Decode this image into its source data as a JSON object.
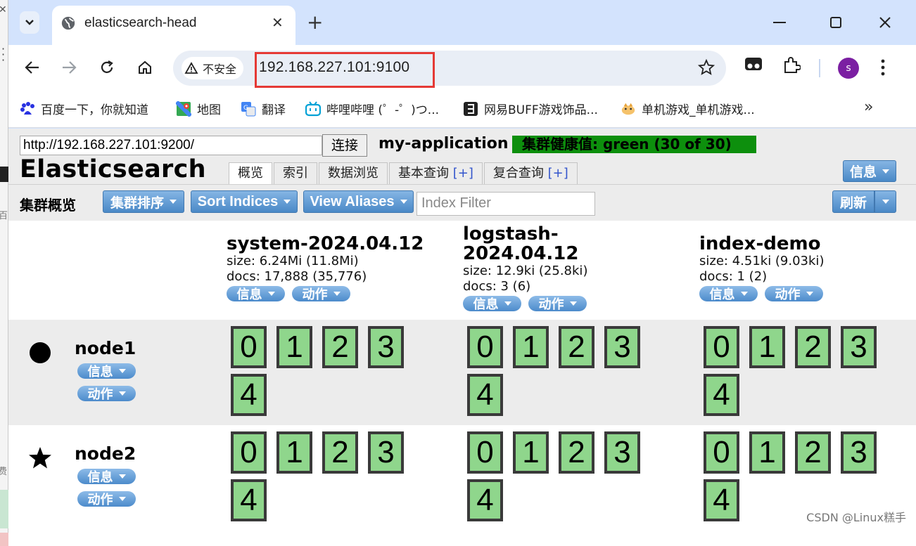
{
  "browser": {
    "tab_title": "elasticsearch-head",
    "security_label": "不安全",
    "url": "192.168.227.101:9100",
    "avatar_letter": "s",
    "bookmarks": [
      {
        "label": "百度一下，你就知道",
        "icon": "baidu-icon"
      },
      {
        "label": "地图",
        "icon": "maps-icon"
      },
      {
        "label": "翻译",
        "icon": "translate-icon"
      },
      {
        "label": "哔哩哔哩 (゜-゜)つ...",
        "icon": "bilibili-icon"
      },
      {
        "label": "网易BUFF游戏饰品...",
        "icon": "buff-icon"
      },
      {
        "label": "单机游戏_单机游戏...",
        "icon": "game-icon"
      }
    ]
  },
  "head": {
    "connect_url": "http://192.168.227.101:9200/",
    "connect_label": "连接",
    "cluster_name": "my-application",
    "health": "集群健康值: green (30 of 30)",
    "health_color": "#0d8f0d",
    "logo": "Elasticsearch",
    "tabs": [
      {
        "label": "概览",
        "plus": ""
      },
      {
        "label": "索引",
        "plus": ""
      },
      {
        "label": "数据浏览",
        "plus": ""
      },
      {
        "label": "基本查询 ",
        "plus": "[+]"
      },
      {
        "label": "复合查询 ",
        "plus": "[+]"
      }
    ],
    "info_label": "信息"
  },
  "subbar": {
    "title": "集群概览",
    "sort_cluster": "集群排序",
    "sort_indices": "Sort Indices",
    "view_aliases": "View Aliases",
    "filter_placeholder": "Index Filter",
    "refresh": "刷新"
  },
  "indices": [
    {
      "name": "system-2024.04.12",
      "size": "size: 6.24Mi (11.8Mi)",
      "docs": "docs: 17,888 (35,776)",
      "info": "信息",
      "action": "动作"
    },
    {
      "name": "logstash-2024.04.12",
      "size": "size: 12.9ki (25.8ki)",
      "docs": "docs: 3 (6)",
      "info": "信息",
      "action": "动作"
    },
    {
      "name": "index-demo",
      "size": "size: 4.51ki (9.03ki)",
      "docs": "docs: 1 (2)",
      "info": "信息",
      "action": "动作"
    }
  ],
  "nodes": [
    {
      "name": "node1",
      "icon": "circle-icon",
      "info": "信息",
      "action": "动作"
    },
    {
      "name": "node2",
      "icon": "star-icon",
      "info": "信息",
      "action": "动作"
    }
  ],
  "shard_labels": [
    "0",
    "1",
    "2",
    "3",
    "4"
  ],
  "shard_color": "#8fd68c",
  "watermark": "CSDN @Linux糕手"
}
